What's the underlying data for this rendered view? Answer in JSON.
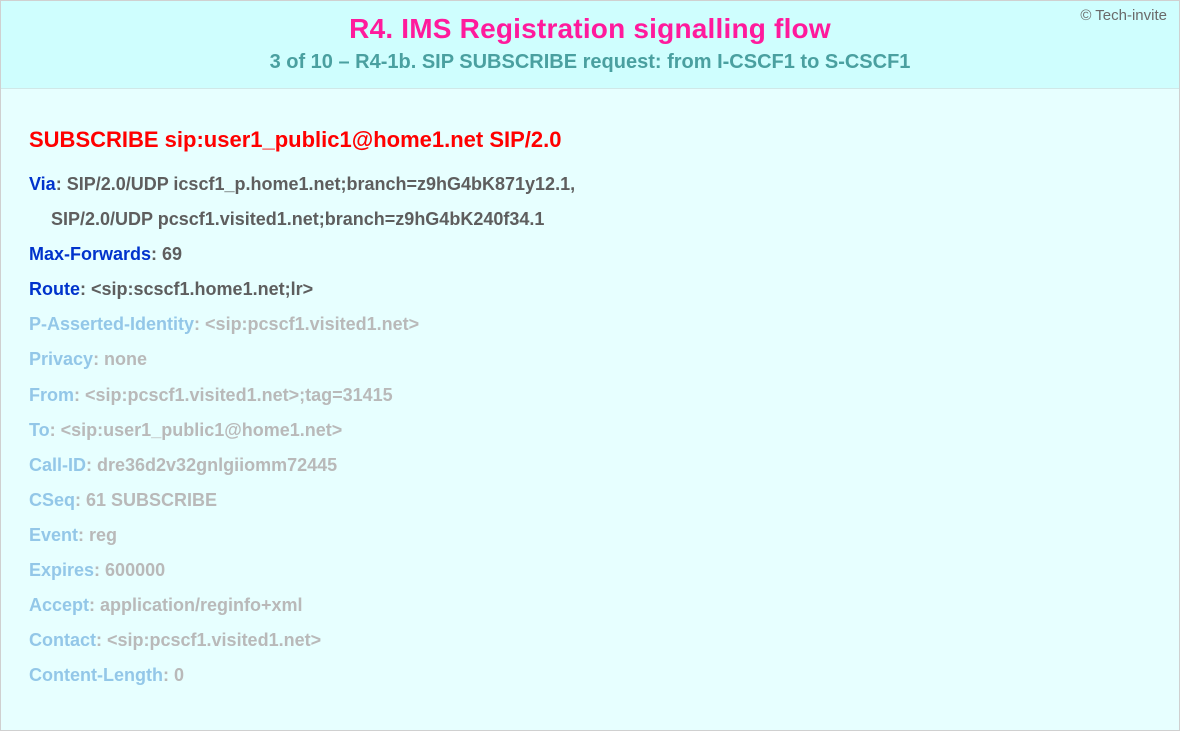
{
  "copyright": "© Tech-invite",
  "title": "R4. IMS Registration signalling flow",
  "subtitle": "3 of 10 – R4-1b. SIP SUBSCRIBE request: from I-CSCF1 to S-CSCF1",
  "request_line": "SUBSCRIBE sip:user1_public1@home1.net SIP/2.0",
  "headers": {
    "via": {
      "key": "Via",
      "value_line1": ": SIP/2.0/UDP icscf1_p.home1.net;branch=z9hG4bK871y12.1,",
      "value_line2": "SIP/2.0/UDP pcscf1.visited1.net;branch=z9hG4bK240f34.1"
    },
    "max_forwards": {
      "key": "Max-Forwards",
      "value": ": 69"
    },
    "route": {
      "key": "Route",
      "value": ": <sip:scscf1.home1.net;lr>"
    },
    "p_asserted_identity": {
      "key": "P-Asserted-Identity",
      "value": ": <sip:pcscf1.visited1.net>"
    },
    "privacy": {
      "key": "Privacy",
      "value": ": none"
    },
    "from": {
      "key": "From",
      "value": ": <sip:pcscf1.visited1.net>;tag=31415"
    },
    "to": {
      "key": "To",
      "value": ": <sip:user1_public1@home1.net>"
    },
    "call_id": {
      "key": "Call-ID",
      "value": ": dre36d2v32gnlgiiomm72445"
    },
    "cseq": {
      "key": "CSeq",
      "value": ": 61 SUBSCRIBE"
    },
    "event": {
      "key": "Event",
      "value": ": reg"
    },
    "expires": {
      "key": "Expires",
      "value": ": 600000"
    },
    "accept": {
      "key": "Accept",
      "value": ": application/reginfo+xml"
    },
    "contact": {
      "key": "Contact",
      "value": ": <sip:pcscf1.visited1.net>"
    },
    "content_length": {
      "key": "Content-Length",
      "value": ": 0"
    }
  }
}
